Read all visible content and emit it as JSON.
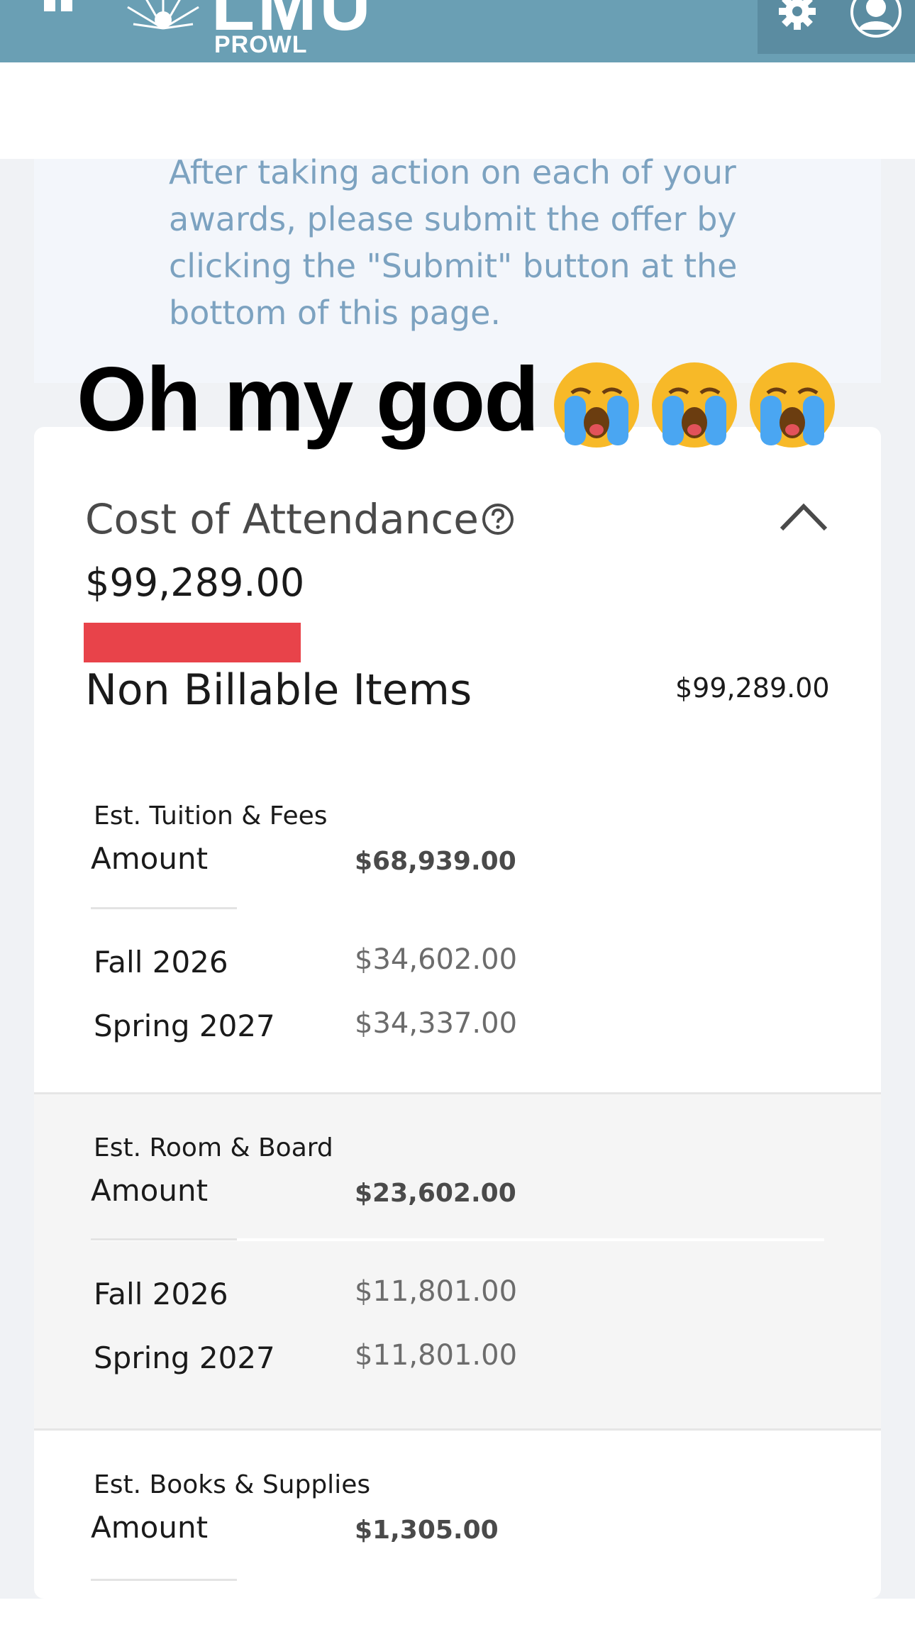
{
  "header": {
    "logo_text": "LMU",
    "logo_subtext": "PROWL",
    "colors": {
      "bar": "#6a9fb4",
      "bar_dark": "#5b8ca1"
    },
    "icons": [
      "grid-icon",
      "logo-star-icon",
      "gear-icon",
      "user-icon"
    ]
  },
  "notice": {
    "text": "After taking action on each of your awards, please submit the offer by clicking the \"Submit\" button at the bottom of this page."
  },
  "overlay": {
    "caption": "Oh my god",
    "emoji": "😭😭😭"
  },
  "cost_of_attendance": {
    "title": "Cost of Attendance",
    "total": "$99,289.00",
    "group_title": "Non Billable Items",
    "group_total": "$99,289.00",
    "items": [
      {
        "label": "Est. Tuition & Fees",
        "amount_label": "Amount",
        "amount": "$68,939.00",
        "terms": [
          {
            "term": "Fall 2026",
            "amount": "$34,602.00"
          },
          {
            "term": "Spring 2027",
            "amount": "$34,337.00"
          }
        ]
      },
      {
        "label": "Est. Room & Board",
        "amount_label": "Amount",
        "amount": "$23,602.00",
        "terms": [
          {
            "term": "Fall 2026",
            "amount": "$11,801.00"
          },
          {
            "term": "Spring 2027",
            "amount": "$11,801.00"
          }
        ]
      },
      {
        "label": "Est. Books & Supplies",
        "amount_label": "Amount",
        "amount": "$1,305.00"
      }
    ]
  }
}
